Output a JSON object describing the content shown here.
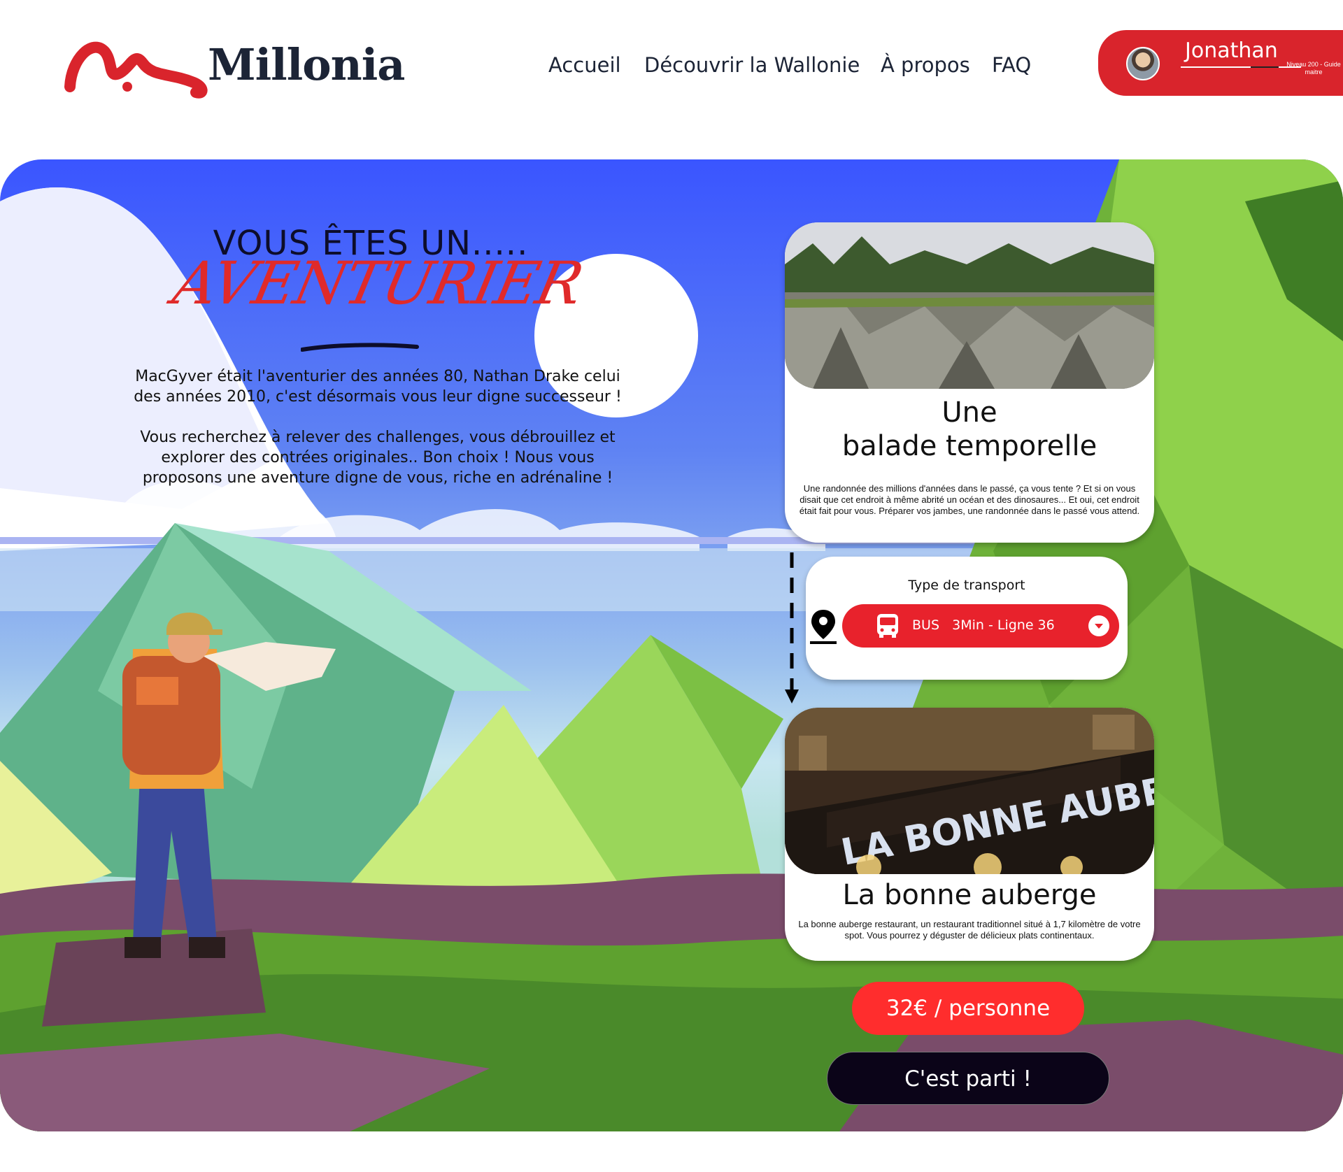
{
  "brand": {
    "name": "Millonia",
    "color": "#d9242c"
  },
  "nav": {
    "items": [
      {
        "label": "Accueil"
      },
      {
        "label": "Découvrir la Wallonie"
      },
      {
        "label": "À propos"
      },
      {
        "label": "FAQ"
      }
    ]
  },
  "user": {
    "name": "Jonathan",
    "level": "Niveau 200 - Guide maitre"
  },
  "hero": {
    "headline_top": "VOUS ÊTES UN.....",
    "headline_script": "AVENTURIER",
    "intro": [
      "MacGyver était l'aventurier des années 80, Nathan Drake celui des années 2010, c'est désormais vous leur digne successeur !",
      "Vous recherchez à relever des challenges, vous débrouillez et explorer des contrées originales.. Bon choix ! Nous vous proposons une aventure digne de vous, riche en adrénaline !"
    ]
  },
  "activity": {
    "title_line1": "Une",
    "title_line2": "balade temporelle",
    "description": "Une randonnée des millions d'années dans le passé, ça vous tente ? Et si on vous disait que cet endroit à même abrité un océan et des dinosaures... Et oui, cet endroit était fait pour vous. Préparer vos jambes, une randonnée dans le passé vous attend."
  },
  "transport": {
    "label": "Type de transport",
    "selected": "BUS   3Min - Ligne 36"
  },
  "restaurant": {
    "title": "La bonne auberge",
    "sign": "LA BONNE AUBERGE",
    "description": "La bonne auberge restaurant, un restaurant traditionnel situé à 1,7 kilomètre de votre spot. Vous pourrez y déguster de délicieux plats continentaux."
  },
  "price_label": "32€ / personne",
  "cta_label": "C'est parti !"
}
